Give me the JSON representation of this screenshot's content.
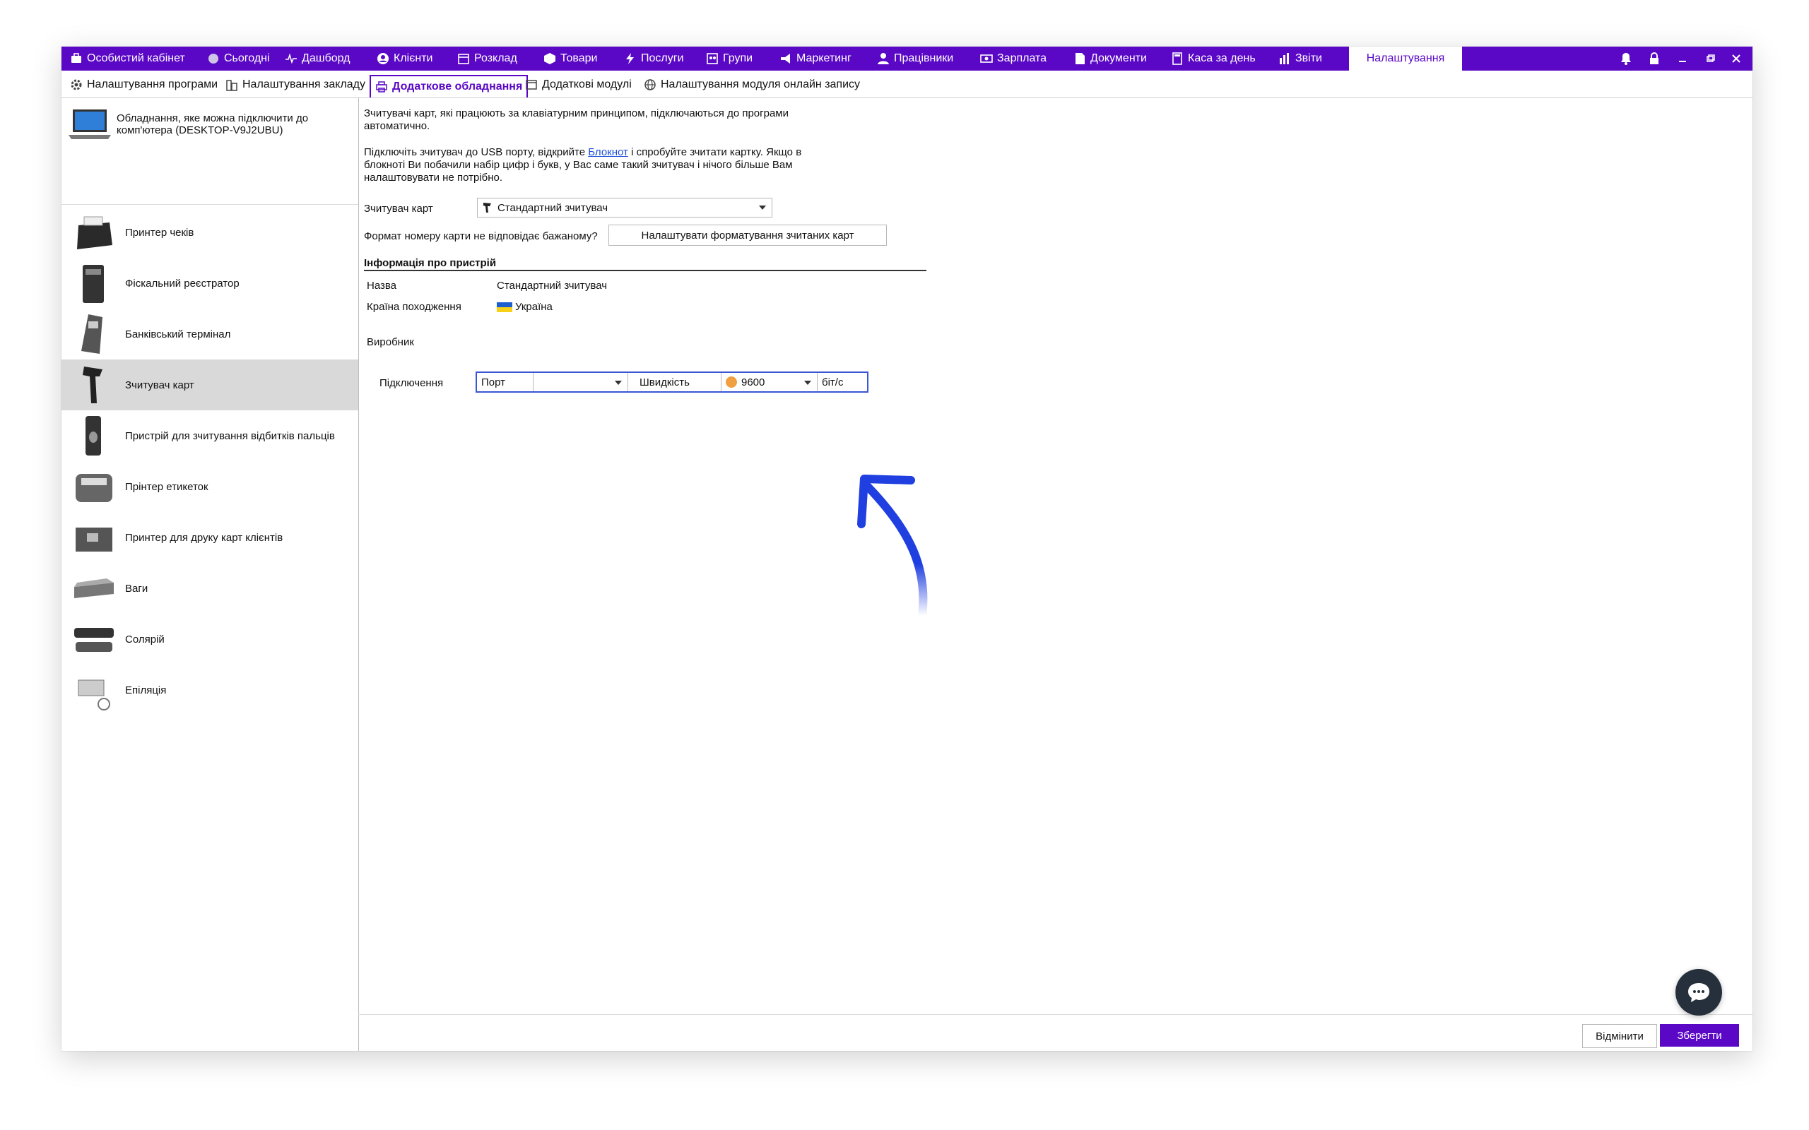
{
  "topnav": {
    "tabs": [
      {
        "label": "Особистий кабінет",
        "icon": "briefcase-icon"
      },
      {
        "label": "Сьогодні",
        "icon": "clock-icon"
      },
      {
        "label": "Дашборд",
        "icon": "pulse-icon"
      },
      {
        "label": "Клієнти",
        "icon": "user-circle-icon"
      },
      {
        "label": "Розклад",
        "icon": "calendar-icon"
      },
      {
        "label": "Товари",
        "icon": "box-icon"
      },
      {
        "label": "Послуги",
        "icon": "lightning-icon"
      },
      {
        "label": "Групи",
        "icon": "group-icon"
      },
      {
        "label": "Маркетинг",
        "icon": "megaphone-icon"
      },
      {
        "label": "Працівники",
        "icon": "person-icon"
      },
      {
        "label": "Зарплата",
        "icon": "money-icon"
      },
      {
        "label": "Документи",
        "icon": "document-icon"
      },
      {
        "label": "Каса за день",
        "icon": "calculator-icon"
      },
      {
        "label": "Звіти",
        "icon": "bar-chart-icon"
      }
    ],
    "active_tab": "Налаштування"
  },
  "subnav": {
    "tabs": [
      {
        "label": "Налаштування програми",
        "icon": "gear-icon"
      },
      {
        "label": "Налаштування закладу",
        "icon": "building-icon"
      },
      {
        "label": "Додаткове обладнання",
        "icon": "printer-icon"
      },
      {
        "label": "Додаткові модулі",
        "icon": "window-icon"
      },
      {
        "label": "Налаштування модуля онлайн запису",
        "icon": "globe-icon"
      }
    ]
  },
  "sidebar": {
    "header": "Обладнання, яке можна підключити до комп'ютера (DESKTOP-V9J2UBU)",
    "items": [
      {
        "label": "Принтер чеків"
      },
      {
        "label": "Фіскальний реєстратор"
      },
      {
        "label": "Банківський термінал"
      },
      {
        "label": "Зчитувач карт"
      },
      {
        "label": "Пристрій для зчитування відбитків пальців"
      },
      {
        "label": "Прінтер етикеток"
      },
      {
        "label": "Принтер для друку карт клієнтів"
      },
      {
        "label": "Ваги"
      },
      {
        "label": "Солярій"
      },
      {
        "label": "Епіляція"
      }
    ],
    "selected_index": 3
  },
  "content": {
    "intro_line1": "Зчитувачі карт, які працюють за клавіатурним принципом, підключаються до програми",
    "intro_line2": "автоматично.",
    "usb_line1_a": "Підключіть зчитувач до USB порту, відкрийте ",
    "usb_link": "Блокнот",
    "usb_line1_b": " і спробуйте зчитати картку. Якщо в",
    "usb_line2": "блокноті Ви побачили набір цифр і букв, у Вас саме такий зчитувач і нічого більше Вам",
    "usb_line3": "налаштовувати не потрібно.",
    "reader_label": "Зчитувач карт",
    "reader_value": "Стандартний зчитувач",
    "format_question": "Формат номеру карти не відповідає бажаному?",
    "format_button": "Налаштувати форматування зчитаних карт",
    "info_title": "Інформація про пристрій",
    "name_label": "Назва",
    "name_value": "Стандартний зчитувач",
    "country_label": "Країна походження",
    "country_value": "Україна",
    "maker_label": "Виробник",
    "connection_label": "Підключення",
    "port_label": "Порт",
    "port_value": "",
    "speed_label": "Швидкість",
    "speed_value": "9600",
    "unit": "біт/с"
  },
  "footer": {
    "cancel": "Відмінити",
    "save": "Зберегти"
  },
  "colors": {
    "brand": "#5a08c6",
    "arrow": "#1f3fe0"
  }
}
